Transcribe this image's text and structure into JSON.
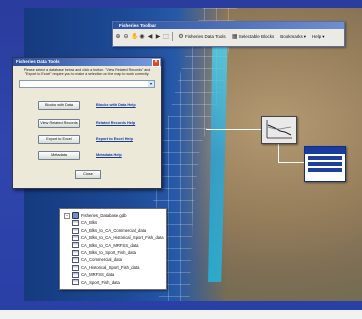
{
  "toolbar": {
    "title": "Fisheries Toolbar",
    "data_tools_label": "Fisheries Data Tools",
    "selectable_blocks_label": "Selectable Blocks",
    "bookmarks_label": "Bookmarks",
    "help_label": "Help",
    "icons": [
      "zoom-in-icon",
      "zoom-out-icon",
      "pan-icon",
      "full-extent-icon",
      "back-icon",
      "forward-icon",
      "select-icon"
    ]
  },
  "data_tools": {
    "title": "Fisheries Data Tools",
    "instruction": "Please select a database below and click a button. \"View Related Records\" and \"Export to Excel\" require you to make a selection on the map to work correctly.",
    "select_value": "",
    "rows": [
      {
        "button": "Blocks with Data",
        "link": "Blocks with Data Help"
      },
      {
        "button": "View Related Records",
        "link": "Related Records Help"
      },
      {
        "button": "Export to Excel",
        "link": "Export to Excel Help"
      },
      {
        "button": "Metadata",
        "link": "Metadata Help"
      }
    ],
    "close_label": "Close"
  },
  "tree": {
    "root": "Fisheries_Database.gdb",
    "items": [
      "CA_Blks",
      "CA_Blks_to_CA_Commercial_data",
      "CA_Blks_to_CA_Historical_Sport_Fish_data",
      "CA_Blks_to_CA_MRFSS_data",
      "CA_Blks_to_Sport_Fish_data",
      "CA_Commercial_data",
      "CA_Historical_Sport_Fish_data",
      "CA_MRFSS_data",
      "CA_Sport_Fish_data"
    ]
  },
  "colors": {
    "background": "#2f46ad",
    "window_title": "#2b4f9a",
    "link": "#1638a8",
    "highlight": "#1fa6e0"
  }
}
